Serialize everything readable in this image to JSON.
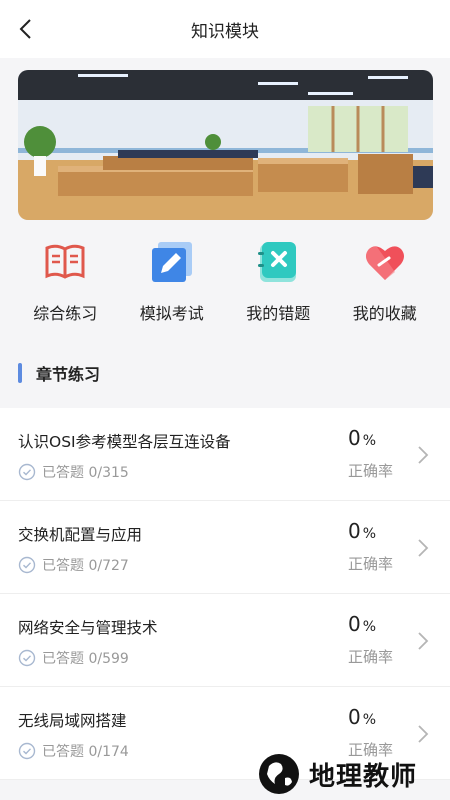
{
  "header": {
    "title": "知识模块"
  },
  "quick_actions": [
    {
      "label": "综合练习",
      "icon": "book-icon",
      "color": "#e0584c"
    },
    {
      "label": "模拟考试",
      "icon": "exam-edit-icon",
      "color": "#3f86e6"
    },
    {
      "label": "我的错题",
      "icon": "wrong-notebook-icon",
      "color": "#2fc9c0"
    },
    {
      "label": "我的收藏",
      "icon": "heart-icon",
      "color": "#f0505a"
    }
  ],
  "section": {
    "title": "章节练习"
  },
  "chapters": [
    {
      "title": "认识OSI参考模型各层互连设备",
      "answered": "已答题 0/315",
      "rate": "0",
      "rate_unit": "%",
      "rate_label": "正确率"
    },
    {
      "title": "交换机配置与应用",
      "answered": "已答题 0/727",
      "rate": "0",
      "rate_unit": "%",
      "rate_label": "正确率"
    },
    {
      "title": "网络安全与管理技术",
      "answered": "已答题 0/599",
      "rate": "0",
      "rate_unit": "%",
      "rate_label": "正确率"
    },
    {
      "title": "无线局域网搭建",
      "answered": "已答题 0/174",
      "rate": "0",
      "rate_unit": "%",
      "rate_label": "正确率"
    }
  ],
  "watermark": {
    "text": "地理教师"
  },
  "colors": {
    "accent": "#5d8be0",
    "muted": "#999999",
    "background": "#f5f5f7"
  }
}
